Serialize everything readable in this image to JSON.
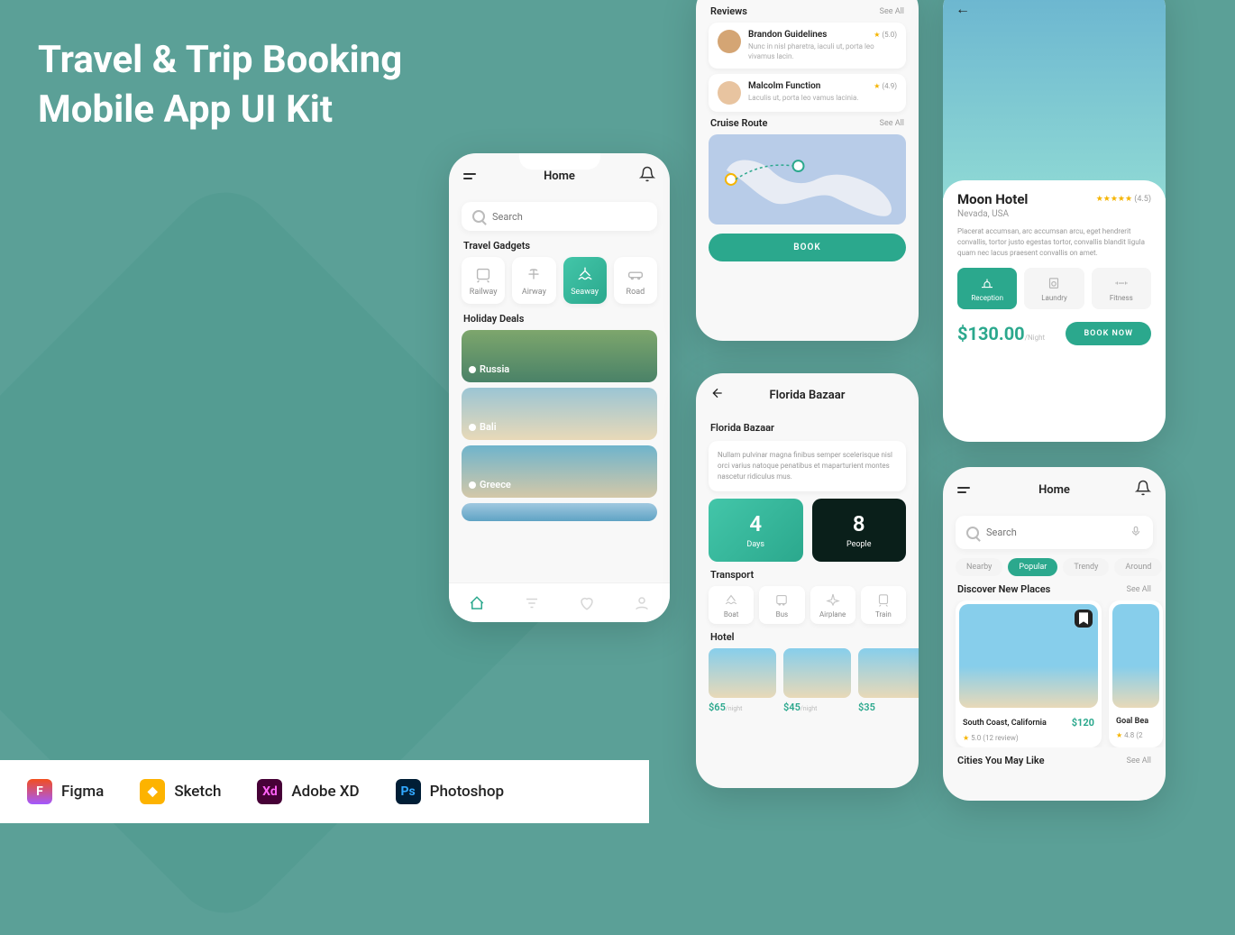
{
  "headline": "Travel & Trip Booking\nMobile App UI Kit",
  "tools": [
    "Figma",
    "Sketch",
    "Adobe XD",
    "Photoshop"
  ],
  "home": {
    "title": "Home",
    "searchPlaceholder": "Search",
    "travelGadgets": "Travel Gadgets",
    "gadgets": [
      "Railway",
      "Airway",
      "Seaway",
      "Road"
    ],
    "holidayDeals": "Holiday Deals",
    "deals": [
      "Russia",
      "Bali",
      "Greece"
    ]
  },
  "reviews": {
    "title": "Reviews",
    "seeAll": "See All",
    "items": [
      {
        "name": "Brandon Guidelines",
        "rating": "(5.0)",
        "text": "Nunc in nisl pharetra, iaculi ut, porta leo vivamus lacin."
      },
      {
        "name": "Malcolm Function",
        "rating": "(4.9)",
        "text": "Laculis ut, porta leo vamus lacinia."
      }
    ],
    "cruiseTitle": "Cruise Route",
    "bookBtn": "BOOK"
  },
  "florida": {
    "title": "Florida Bazaar",
    "subtitle": "Florida Bazaar",
    "desc": "Nullam pulvinar magna finibus semper scelerisque nisl orci varius natoque penatibus et maparturient montes nascetur ridiculus mus.",
    "days": {
      "num": "4",
      "label": "Days"
    },
    "people": {
      "num": "8",
      "label": "People"
    },
    "transportTitle": "Transport",
    "transport": [
      "Boat",
      "Bus",
      "Airplane",
      "Train"
    ],
    "hotelTitle": "Hotel",
    "hotels": [
      {
        "price": "$65",
        "per": "/night"
      },
      {
        "price": "$45",
        "per": "/night"
      },
      {
        "price": "$35",
        "per": ""
      }
    ]
  },
  "moon": {
    "name": "Moon Hotel",
    "rating": "(4.5)",
    "location": "Nevada, USA",
    "desc": "Placerat accumsan, arc accumsan arcu, eget hendrerit convallis, tortor justo egestas tortor, convallis blandit ligula quam nec lacus praesent convallis on amet.",
    "amenities": [
      "Reception",
      "Laundry",
      "Fitness"
    ],
    "price": "$130.00",
    "per": "/Night",
    "bookNow": "BOOK NOW"
  },
  "discover": {
    "title": "Home",
    "searchPlaceholder": "Search",
    "filters": [
      "Nearby",
      "Popular",
      "Trendy",
      "Around"
    ],
    "discoverTitle": "Discover New Places",
    "seeAll": "See All",
    "places": [
      {
        "name": "South Coast, California",
        "price": "$120",
        "rating": "5.0 (12 review)"
      },
      {
        "name": "Goal Bea",
        "price": "",
        "rating": "4.8 (2"
      }
    ],
    "citiesTitle": "Cities You May Like"
  }
}
